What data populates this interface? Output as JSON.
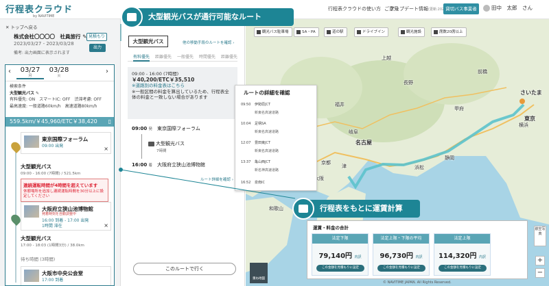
{
  "header": {
    "logo_title": "行程表クラウド",
    "logo_sub": "by NAVITIME",
    "nav_usage": "行程表クラウドの使い方",
    "nav_feedback": "ご意見",
    "nav_update": "アップデート情報",
    "nav_update_date": "(更新:2023/02/24)",
    "rental_button": "貸切バス事業者",
    "user_name": "田中　太郎　さん"
  },
  "left_panel": {
    "back_link": "トップへ戻る",
    "client": "株式会社〇〇〇〇　社員旅行",
    "date_range": "2023/03/27 - 2023/03/28",
    "estimate_button": "見積もり",
    "output_button": "出力",
    "note": "備考: 出力画面に表示されます",
    "day_tabs": [
      {
        "date": "03/27",
        "weekday": "月"
      },
      {
        "date": "03/28",
        "weekday": "火"
      }
    ],
    "search_conditions_label": "検索条件",
    "vehicle": "大型観光バス",
    "road_settings": "有料優先: ON　スマートIC: OFF　渋滞考慮: OFF",
    "speed_settings": "最高速度: 一般道路60km/h　高速道路80km/h",
    "total": "559.5km/￥45,960/ETC￥38,420",
    "stops": [
      {
        "name": "東京国際フォーラム",
        "time": "09:00 出発"
      },
      {
        "name": "大阪府立狭山池博物館",
        "time": "16:00 到着 - 17:00 出発",
        "stay": "1時間 滞在",
        "flag": "発着時刻を自動調整中"
      },
      {
        "name": "大阪市中央公会堂",
        "time": "17:00 到着"
      }
    ],
    "segments": [
      {
        "title": "大型観光バス",
        "sub": "09:00 - 16:00 (7時間) / 521.5km"
      },
      {
        "title": "大型観光バス",
        "sub": "17:00 - 18:03 (1時間3分) / 38.0km"
      }
    ],
    "warning_title": "連続運転時間が4時間を超えています",
    "warning_body": "休憩場所を追加し連続運転時間を30分以上に設定してください",
    "wait_label": "待ち時間 (3時間)"
  },
  "route_panel": {
    "title": "大型観光バス",
    "other_route_link": "他の移動手段のルートを確認",
    "tabs": [
      "有料優先",
      "距離優先",
      "一般優先",
      "時間優先",
      "距離優先"
    ],
    "summary_time": "09:00 - 16:00 (7時間)",
    "summary_fare": "￥40,200/ETC￥35,510",
    "summary_note1": "※道路別の料金表はこちら",
    "summary_note2": "※一般区間の料金を算出しているため、行程表全体の料金と一致しない場合があります",
    "dep_time": "09:00",
    "dep_tag": "発",
    "dep_name": "東京国際フォーラム",
    "mode_name": "大型観光バス",
    "mode_duration": "7時間",
    "arr_time": "16:00",
    "arr_tag": "着",
    "arr_name": "大阪府立狭山池博物館",
    "detail_link": "ルート詳細を確認",
    "go_button": "このルートで行く"
  },
  "map_filters": [
    "観光バス駐車場",
    "SA・PA",
    "道の駅",
    "ドライブイン",
    "観光施設",
    "席数20席以上"
  ],
  "map_labels": [
    "上越",
    "長野",
    "前橋",
    "甲府",
    "さいたま",
    "東京",
    "横浜",
    "静岡",
    "浜松",
    "名古屋",
    "岐阜",
    "津",
    "京都",
    "大阪",
    "和歌山",
    "鳥取",
    "福井"
  ],
  "route_detail": {
    "title": "ルートの詳細を確認",
    "rows": [
      {
        "time": "09:50",
        "name": "伊勢原JCT",
        "road": "新東名高速道路"
      },
      {
        "time": "10:04",
        "name": "足柄SA",
        "road": "新東名高速道路"
      },
      {
        "time": "12:07",
        "name": "豊田東JCT",
        "road": "新東名高速道路"
      },
      {
        "time": "13:37",
        "name": "亀山西JCT",
        "road": "新名神高速道路"
      },
      {
        "time": "16:52",
        "name": "泉南IC",
        "road": ""
      }
    ]
  },
  "callouts": {
    "top": "大型観光バスが通行可能なルート",
    "bottom": "行程表をもとに運賃計算"
  },
  "fare": {
    "title": "運賃・料金の合計",
    "columns": [
      {
        "label": "法定下限",
        "value": "79,140円",
        "detail": "内訳",
        "button": "この金額を見積もりに設定"
      },
      {
        "label": "法定上限・下限の平均",
        "value": "96,730円",
        "detail": "内訳",
        "button": "この金額を見積もりに設定"
      },
      {
        "label": "法定上限",
        "value": "114,320円",
        "detail": "内訳",
        "button": "この金額を見積もりに設定"
      }
    ]
  },
  "map_controls": {
    "layer_label": "重ね地図",
    "aerial_label": "航空写真",
    "zoom_in": "+",
    "zoom_out": "−",
    "copyright": "© NAVITIME JAPAN. All Rights Reserved."
  }
}
